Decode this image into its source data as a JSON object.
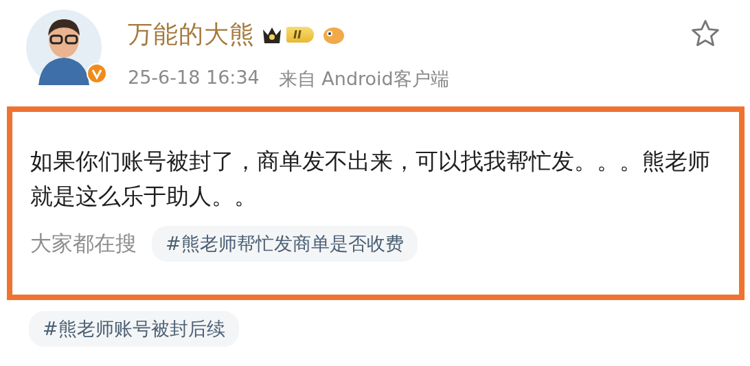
{
  "author": {
    "name": "万能的大熊",
    "verified": true,
    "level_badge": "II"
  },
  "post": {
    "time": "25-6-18 16:34",
    "source": "来自 Android客户端",
    "favorited": false,
    "highlighted": true,
    "text": "如果你们账号被封了，商单发不出来，可以找我帮忙发。。。熊老师就是这么乐于助人。。",
    "trending_label": "大家都在搜",
    "topics": [
      "#熊老师帮忙发商单是否收费"
    ]
  },
  "more_topics": [
    "#熊老师账号被封后续"
  ]
}
